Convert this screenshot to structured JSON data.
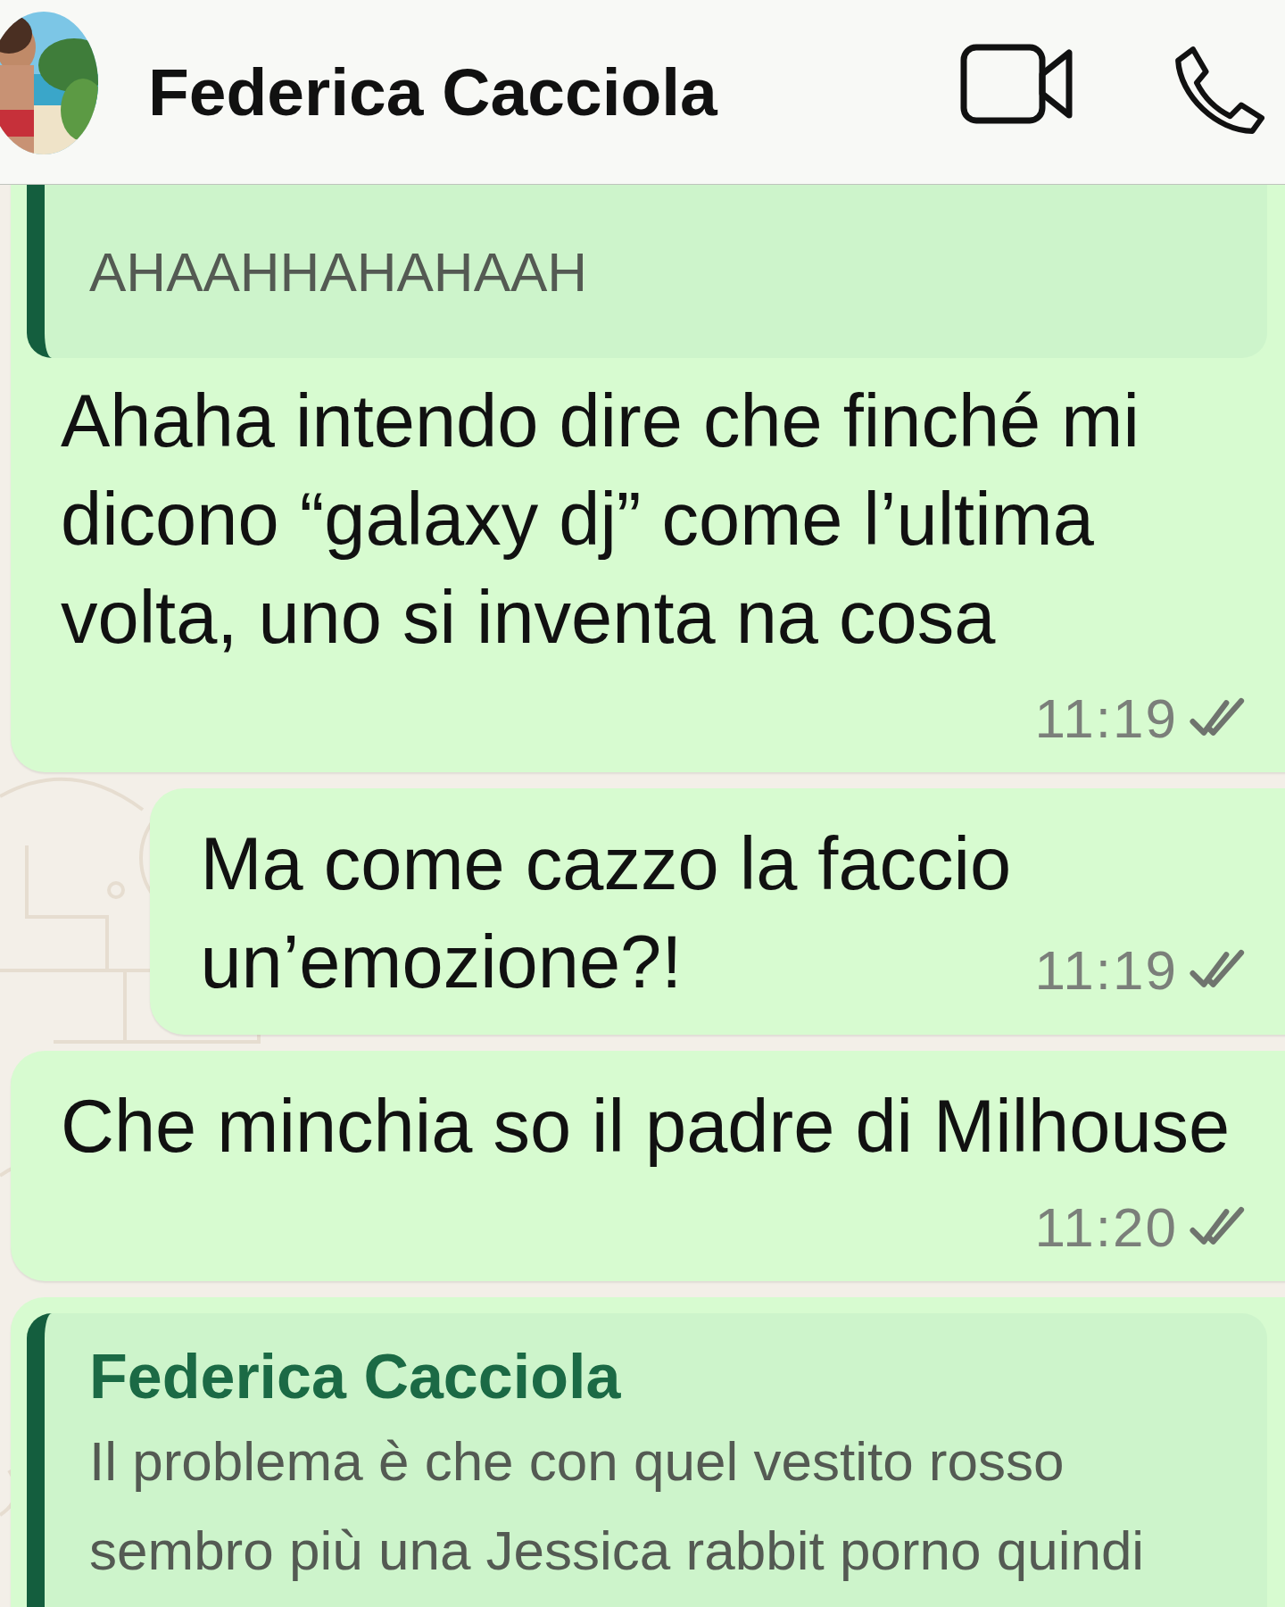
{
  "header": {
    "contact_name": "Federica Cacciola"
  },
  "messages": [
    {
      "quote": {
        "text": "AHAAHHAHAHAAH"
      },
      "text": "Ahaha intendo dire che finché mi dicono “galaxy dj” come l’ultima volta, uno si inventa na cosa",
      "time": "11:19",
      "read": false
    },
    {
      "text": "Ma come cazzo la faccio un’emozione?!",
      "time": "11:19",
      "read": false
    },
    {
      "text": "Che minchia so il padre di Milhouse",
      "time": "11:20",
      "read": false
    },
    {
      "quote": {
        "author": "Federica Cacciola",
        "text": "Il problema è che con quel vestito rosso sembro più una Jessica rabbit porno quindi"
      }
    }
  ]
}
